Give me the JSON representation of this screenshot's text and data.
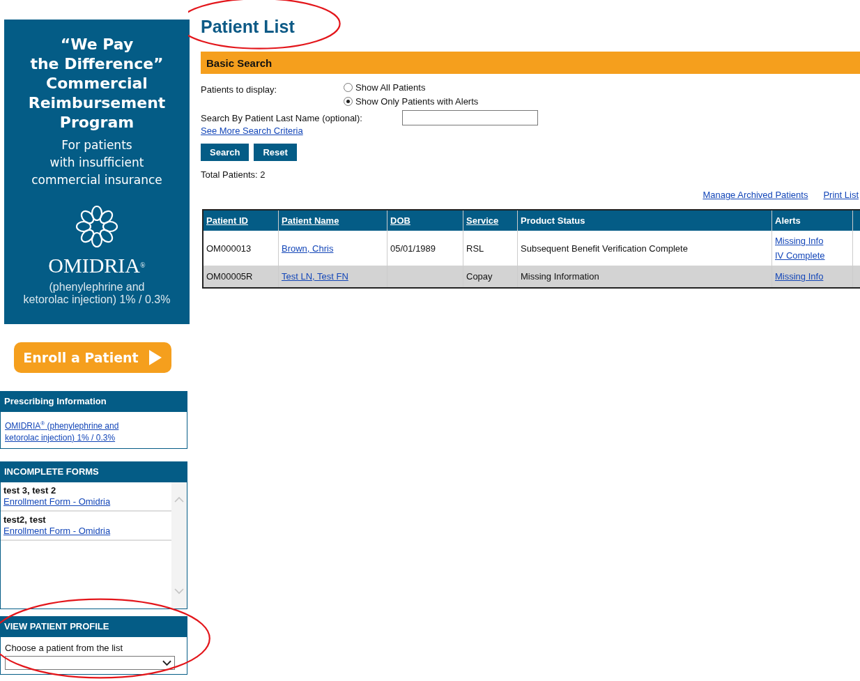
{
  "promo": {
    "headline": [
      "“We Pay",
      "the Difference”",
      "Commercial",
      "Reimbursement",
      "Program"
    ],
    "subhead": [
      "For patients",
      "with insufficient",
      "commercial insurance"
    ],
    "brand": "OMIDRIA$^{®}$",
    "generic": [
      "(phenylephrine and",
      "ketorolac injection) 1% / 0.3%"
    ]
  },
  "enroll_button": "Enroll a Patient",
  "prescribing": {
    "title": "Prescribing Information",
    "link": "OMIDRIA$^{®}$ (phenylephrine and ketorolac injection) 1% / 0.3%"
  },
  "incomplete_forms": {
    "title": "INCOMPLETE FORMS",
    "items": [
      {
        "name": "test 3, test 2",
        "link": "Enrollment Form - Omidria"
      },
      {
        "name": "test2, test",
        "link": "Enrollment Form - Omidria"
      }
    ]
  },
  "view_profile": {
    "title": "VIEW PATIENT PROFILE",
    "label": "Choose a patient from the list",
    "circled": true
  },
  "page_title": {
    "text": "Patient List",
    "circled": true
  },
  "search": {
    "title": "Basic Search",
    "display_label": "Patients to display:",
    "options": [
      {
        "label": "Show All Patients",
        "selected": false
      },
      {
        "label": "Show Only Patients with Alerts",
        "selected": true
      }
    ],
    "last_name_label": "Search By Patient Last Name (optional):",
    "more_link": "See More Search Criteria",
    "buttons": [
      "Search",
      "Reset"
    ],
    "total": "Total Patients: 2"
  },
  "links": [
    "Manage Archived Patients",
    "Print List"
  ],
  "table": {
    "columns": [
      {
        "label": "Patient ID",
        "sortable": true
      },
      {
        "label": "Patient Name",
        "sortable": true
      },
      {
        "label": "DOB",
        "sortable": true
      },
      {
        "label": "Service",
        "sortable": true
      },
      {
        "label": "Product Status",
        "sortable": false
      },
      {
        "label": "Alerts",
        "sortable": false
      }
    ],
    "rows": [
      {
        "cells": [
          "OM000013",
          "Brown, Chris",
          "05/01/1989",
          "RSL",
          "Subsequent Benefit Verification Complete"
        ],
        "alerts": [
          "Missing Info",
          "IV Complete"
        ]
      },
      {
        "cells": [
          "OM00005R",
          "Test LN, Test FN",
          "",
          "Copay",
          "Missing Information"
        ],
        "alerts": [
          "Missing Info"
        ]
      }
    ]
  }
}
